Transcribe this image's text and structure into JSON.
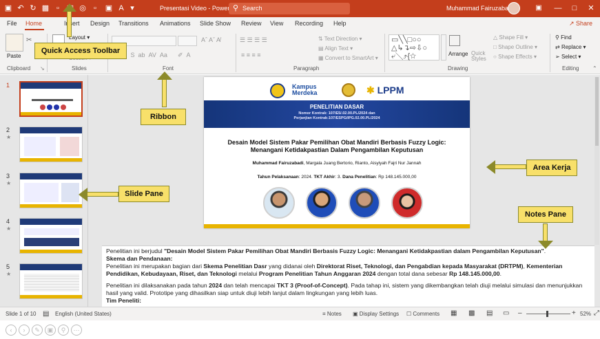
{
  "titlebar": {
    "doc_title": "Presentasi Video - PowerPoint",
    "search_placeholder": "Search",
    "user_name": "Muhammad Fairuzabadi",
    "accent": "#c43e1c"
  },
  "menu": {
    "tabs": [
      "File",
      "Home",
      "Insert",
      "Design",
      "Transitions",
      "Animations",
      "Slide Show",
      "Review",
      "View",
      "Recording",
      "Help"
    ],
    "share_label": "Share"
  },
  "ribbon": {
    "clipboard": {
      "paste": "Paste",
      "label": "Clipboard"
    },
    "slides": {
      "layout": "Layout",
      "section": "Section",
      "label": "Slides"
    },
    "font": {
      "label": "Font"
    },
    "paragraph": {
      "text_direction": "Text Direction",
      "align_text": "Align Text",
      "convert_smartart": "Convert to SmartArt",
      "label": "Paragraph"
    },
    "drawing": {
      "arrange": "Arrange",
      "quick_styles": "Quick Styles",
      "shape_fill": "Shape Fill",
      "shape_outline": "Shape Outline",
      "shape_effects": "Shape Effects",
      "label": "Drawing"
    },
    "editing": {
      "find": "Find",
      "replace": "Replace",
      "select": "Select",
      "label": "Editing"
    }
  },
  "slides_pane": {
    "numbers": [
      "1",
      "2",
      "3",
      "4",
      "5"
    ]
  },
  "slide": {
    "logo_text": "LPPM",
    "kampus_merdeka": "Kampus Merdeka",
    "header_title": "PENELITIAN DASAR",
    "contract_1": "Nomor Kontrak: 107/E5/.02.00.PL/2024 dan",
    "contract_2": "Perjanjian Kontrak:107/ESPG/IPG.02.00.PL/2024",
    "title_line1": "Desain Model Sistem Pakar Pemilihan Obat Mandiri Berbasis Fuzzy Logic:",
    "title_line2": "Menangani Ketidakpastian Dalam Pengambilan Keputusan",
    "authors_bold": "Muhammad Fairuzabadi",
    "authors_rest": ", Margala Juang Bertorio, Rianto, Aisyiyah Fajri Nur Jannah",
    "meta_year_label": "Tahun Pelaksanaan",
    "meta_year": ": 2024. ",
    "meta_tkt_label": "TKT Akhir",
    "meta_tkt": ": 3. ",
    "meta_fund_label": "Dana Penelitian",
    "meta_fund": ": Rp 148.145.000,00"
  },
  "notes": {
    "p1_pre": "Penelitian ini berjudul ",
    "p1_title": "\"Desain Model Sistem Pakar Pemilihan Obat Mandiri Berbasis Fuzzy Logic: Menangani Ketidakpastian dalam Pengambilan Keputusan\"",
    "p1_post": ".",
    "h_skema": "Skema dan Pendanaan:",
    "p2_a": "Penelitian ini merupakan bagian dari ",
    "p2_b": "Skema Penelitian Dasr",
    "p2_c": " yang didanai oleh ",
    "p2_d": "Direktorat Riset, Teknologi, dan Pengabdian kepada Masyarakat (DRTPM)",
    "p2_e": ", ",
    "p2_f": "Kementerian Pendidikan, Kebudayaan, Riset, dan Teknologi",
    "p2_g": " melalui ",
    "p2_h": "Program Penelitian Tahun Anggaran 2024",
    "p2_i": " dengan total dana sebesar ",
    "p2_j": "Rp 148.145.000,00",
    "p2_k": ".",
    "p3_a": "Penelitian ini dilaksanakan pada tahun ",
    "p3_b": "2024",
    "p3_c": " dan telah mencapai ",
    "p3_d": "TKT 3 (Proof-of-Concept)",
    "p3_e": ". Pada tahap ini, sistem yang dikembangkan telah diuji melalui simulasi dan menunjukkan hasil yang valid. Prototipe yang dihasilkan siap untuk diuji lebih lanjut dalam lingkungan yang lebih luas.",
    "h_tim": "Tim Peneliti:"
  },
  "statusbar": {
    "slide_info": "Slide 1 of 10",
    "language": "English (United States)",
    "notes": "Notes",
    "display_settings": "Display Settings",
    "comments": "Comments",
    "zoom": "52%"
  },
  "callouts": {
    "quick_access": "Quick Access Toolbar",
    "ribbon": "Ribbon",
    "slide_pane": "Slide Pane",
    "area_kerja": "Area Kerja",
    "notes_pane": "Notes Pane"
  }
}
